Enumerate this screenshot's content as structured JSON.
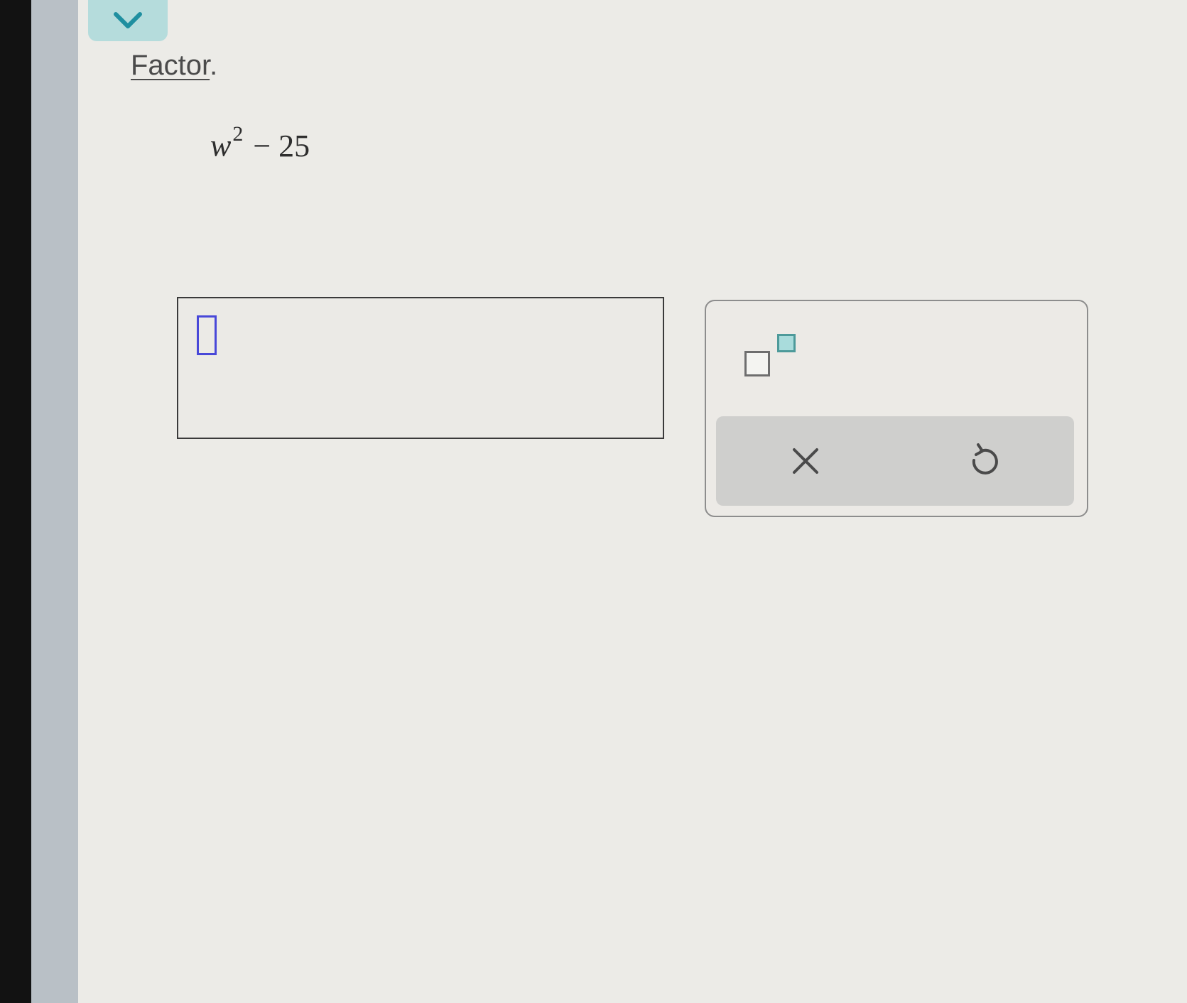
{
  "header": {
    "collapse_icon": "chevron-down-icon",
    "accent_color": "#b5dcdc"
  },
  "question": {
    "instruction_word": "Factor",
    "instruction_punct": ".",
    "expression": {
      "variable": "w",
      "exponent": "2",
      "rest": "− 25"
    }
  },
  "answer": {
    "value": "",
    "cursor_color": "#4848d8"
  },
  "keypad": {
    "superscript_key_icon": "superscript-template-icon",
    "clear_icon": "close-icon",
    "undo_icon": "undo-icon"
  }
}
